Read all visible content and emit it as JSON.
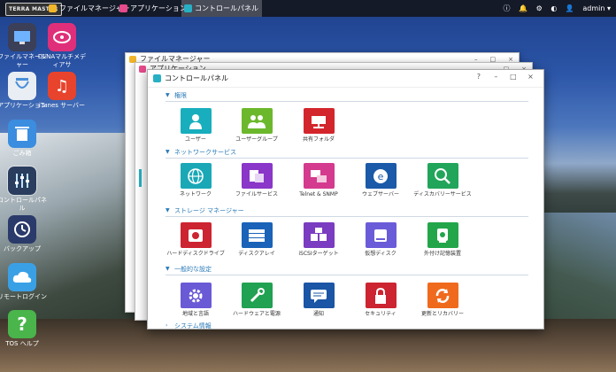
{
  "taskbar": {
    "logo": "TERRA MASTER",
    "tabs": [
      {
        "label": "ファイルマネージャー",
        "color": "#f2b62b"
      },
      {
        "label": "アプリケーション",
        "color": "#e84a8c"
      },
      {
        "label": "コントロールパネル",
        "color": "#27b0c4"
      }
    ],
    "right": {
      "info_icon": "i",
      "user": "admin ▾"
    }
  },
  "desktop": {
    "icons": [
      {
        "label": "ファイルマネージャー",
        "icon": "file-manager-icon",
        "color": "#3b3f57"
      },
      {
        "label": "DLNAマルチメディアサ",
        "icon": "dlna-icon",
        "color": "#e02f7a"
      },
      {
        "label": "アプリケーション",
        "icon": "apps-icon",
        "color": "#e9eef4"
      },
      {
        "label": "iTunes サーバー",
        "icon": "itunes-icon",
        "color": "#e8432d"
      },
      {
        "label": "ごみ箱",
        "icon": "trash-icon",
        "color": "#3b8de0"
      },
      {
        "label": "コントロールパネル",
        "icon": "control-panel-icon",
        "color": "#2a3d5e"
      },
      {
        "label": "バックアップ",
        "icon": "backup-icon",
        "color": "#2a3a6a"
      },
      {
        "label": "リモートログイン",
        "icon": "remote-login-icon",
        "color": "#3aa0e6"
      },
      {
        "label": "TOS ヘルプ",
        "icon": "help-icon",
        "color": "#49b54a"
      }
    ]
  },
  "back_windows": [
    {
      "title": "ファイルマネージャー",
      "color": "#f2b62b"
    },
    {
      "title": "アプリケーション",
      "color": "#e84a8c"
    }
  ],
  "window": {
    "title": "コントロールパネル",
    "buttons": [
      "?",
      "–",
      "□",
      "×"
    ],
    "sections": [
      {
        "label": "権限",
        "items": [
          {
            "label": "ユーザー",
            "color": "#18aebd"
          },
          {
            "label": "ユーザーグループ",
            "color": "#6cb82c"
          },
          {
            "label": "共有フォルダ",
            "color": "#d3262c"
          }
        ]
      },
      {
        "label": "ネットワークサービス",
        "items": [
          {
            "label": "ネットワーク",
            "color": "#1aa8b7"
          },
          {
            "label": "ファイルサービス",
            "color": "#8a36c9"
          },
          {
            "label": "Telnet & SNMP",
            "color": "#d43a8e"
          },
          {
            "label": "ウェブサーバー",
            "color": "#1a5aa8"
          },
          {
            "label": "ディスカバリーサービス",
            "color": "#21a55a"
          }
        ]
      },
      {
        "label": "ストレージ マネージャー",
        "items": [
          {
            "label": "ハードディスクドライブ",
            "color": "#cc2430"
          },
          {
            "label": "ディスクアレイ",
            "color": "#1a63b8"
          },
          {
            "label": "iSCSIターゲット",
            "color": "#7a3cc0"
          },
          {
            "label": "仮想ディスク",
            "color": "#6a5cd8"
          },
          {
            "label": "外付け記憶装置",
            "color": "#23a54a"
          }
        ]
      },
      {
        "label": "一般的な設定",
        "items": [
          {
            "label": "地域と言語",
            "color": "#6a5ad6"
          },
          {
            "label": "ハードウェアと電源",
            "color": "#21a152"
          },
          {
            "label": "通知",
            "color": "#1a55a6"
          },
          {
            "label": "セキュリティ",
            "color": "#cc2430"
          },
          {
            "label": "更新とリカバリー",
            "color": "#f06a1e"
          }
        ]
      },
      {
        "label": "システム情報",
        "items": []
      }
    ]
  }
}
